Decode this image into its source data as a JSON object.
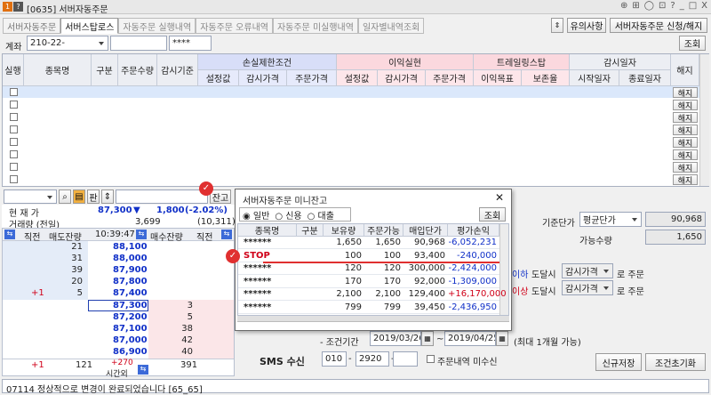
{
  "window": {
    "badge1": "1",
    "badge2": "?",
    "title": "[0635] 서버자동주문",
    "controls": [
      "⊕",
      "⊞",
      "◯",
      "⊡",
      "?",
      "_",
      "□",
      "X"
    ]
  },
  "tabs": [
    "서버자동주문",
    "서버스탑로스",
    "자동주문 실행내역",
    "자동주문 오류내역",
    "자동주문 미실행내역",
    "일자별내역조회"
  ],
  "toolbar": {
    "notice": "유의사항",
    "apply": "서버자동주문 신청/해지"
  },
  "account": {
    "label": "계좌",
    "number": "210-22-",
    "password": "****",
    "query": "조회"
  },
  "grid": {
    "exec": "실행",
    "name": "종목명",
    "type": "구분",
    "qty": "주문수량",
    "monitor": "감시기준",
    "loss_group": "손실제한조건",
    "loss_cols": [
      "설정값",
      "감시가격",
      "주문가격"
    ],
    "profit_group": "이익실현",
    "profit_cols": [
      "설정값",
      "감시가격",
      "주문가격"
    ],
    "trail_group": "트레일링스탑",
    "trail_cols": [
      "이익목표",
      "보존율"
    ],
    "period_group": "감시일자",
    "period_cols": [
      "시작일자",
      "종료일자"
    ],
    "cancel": "해지",
    "cancel_btn": "해지"
  },
  "lower": {
    "balance_btn": "잔고",
    "cur_label": "현 재 가",
    "cur_price": "87,300",
    "change_arrow": "▼",
    "change": "1,800",
    "change_pct": "(-2.02%)",
    "vol_label": "거래량 (전일)",
    "vol": "3,699",
    "vol_prev": "(10,311)",
    "ob_headers": [
      "직전",
      "매도잔량",
      "10:39:47",
      "매수잔량",
      "직전"
    ],
    "asks": [
      {
        "qty": "21",
        "price": "88,100",
        "prev": ""
      },
      {
        "qty": "31",
        "price": "88,000",
        "prev": ""
      },
      {
        "qty": "39",
        "price": "87,900",
        "prev": ""
      },
      {
        "qty": "20",
        "price": "87,800",
        "prev": ""
      },
      {
        "qty": "5",
        "price": "87,400",
        "prev": "+1"
      }
    ],
    "bids": [
      {
        "price": "87,300",
        "qty": "3"
      },
      {
        "price": "87,200",
        "qty": "5"
      },
      {
        "price": "87,100",
        "qty": "38"
      },
      {
        "price": "87,000",
        "qty": "42"
      },
      {
        "price": "86,900",
        "qty": "40"
      }
    ],
    "sum_prev": "+1",
    "sum_ask": "121",
    "sum_diff": "+270",
    "sum_bid": "391",
    "after_hours": "시간외",
    "base_label": "기준단가",
    "base_type": "평균단가",
    "base_value": "90,968",
    "avail_label": "가능수량",
    "avail_value": "1,650",
    "cond1_suffix": "이하",
    "cond2_suffix": "이상",
    "reach": "도달시",
    "watch_price": "감시가격",
    "order_suffix": "로 주문",
    "period_label": "- 조건기간",
    "date_from": "2019/03/26",
    "date_sep": "~",
    "date_to": "2019/04/25",
    "period_note": "(최대 1개월 가능)",
    "sms_label": "SMS 수신",
    "phone1": "010",
    "phone2": "2920",
    "phone3": "",
    "sms_check": "주문내역 미수신",
    "save_btn": "신규저장",
    "reset_btn": "조건초기화"
  },
  "popup": {
    "title": "서버자동주문 미니잔고",
    "radios": [
      "일반",
      "신용",
      "대출"
    ],
    "query": "조회",
    "headers": [
      "종목명",
      "구분",
      "보유량",
      "주문가능",
      "매입단가",
      "평가손익"
    ],
    "rows": [
      [
        "******",
        "",
        "1,650",
        "1,650",
        "90,968",
        "-6,052,231"
      ],
      [
        "STOP",
        "",
        "100",
        "100",
        "93,400",
        "-240,000"
      ],
      [
        "******",
        "",
        "120",
        "120",
        "300,000",
        "-2,424,000"
      ],
      [
        "******",
        "",
        "170",
        "170",
        "92,000",
        "-1,309,000"
      ],
      [
        "******",
        "",
        "2,100",
        "2,100",
        "129,400",
        "+16,170,000"
      ],
      [
        "******",
        "",
        "799",
        "799",
        "39,450",
        "-2,436,950"
      ]
    ]
  },
  "status": "07114 정상적으로 변경이 완료되었습니다 [65_65]"
}
